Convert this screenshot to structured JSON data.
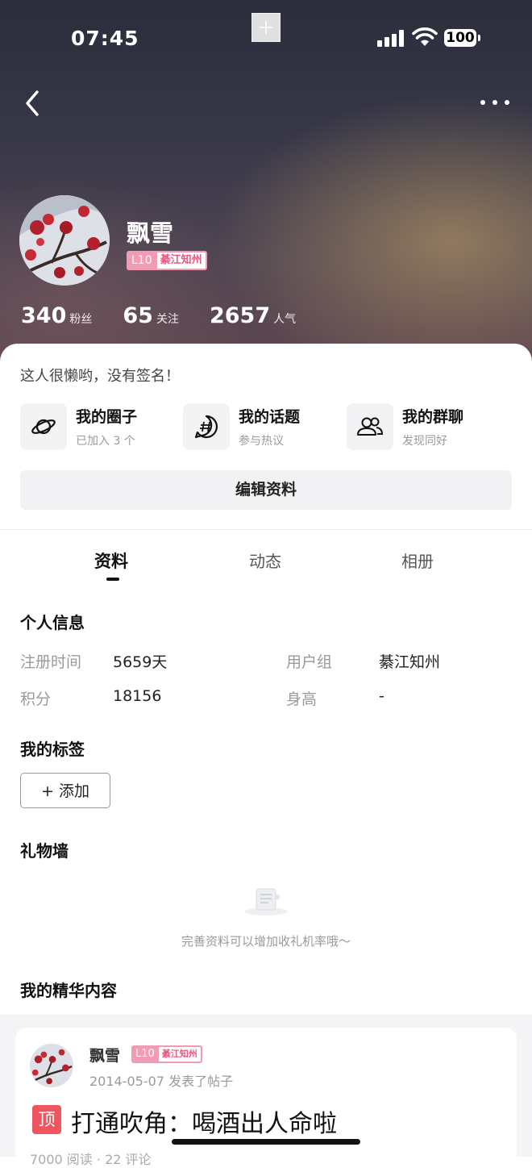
{
  "status_bar": {
    "time": "07:45",
    "battery": "100"
  },
  "profile": {
    "name": "飘雪",
    "level": "L10",
    "group_badge": "綦江知州",
    "stats": [
      {
        "value": "340",
        "label": "粉丝"
      },
      {
        "value": "65",
        "label": "关注"
      },
      {
        "value": "2657",
        "label": "人气"
      }
    ],
    "signature": "这人很懒哟，没有签名！"
  },
  "quick_links": [
    {
      "title": "我的圈子",
      "subtitle": "已加入 3 个",
      "icon": "planet-icon"
    },
    {
      "title": "我的话题",
      "subtitle": "参与热议",
      "icon": "hashtag-chat-icon"
    },
    {
      "title": "我的群聊",
      "subtitle": "发现同好",
      "icon": "group-users-icon"
    }
  ],
  "edit_button": "编辑资料",
  "tabs": [
    "资料",
    "动态",
    "相册"
  ],
  "active_tab": "资料",
  "personal_info": {
    "title": "个人信息",
    "fields": [
      {
        "label": "注册时间",
        "value": "5659天"
      },
      {
        "label": "用户组",
        "value": "綦江知州"
      },
      {
        "label": "积分",
        "value": "18156"
      },
      {
        "label": "身高",
        "value": "-"
      }
    ]
  },
  "tags": {
    "title": "我的标签",
    "add_label": "+ 添加"
  },
  "gift_wall": {
    "title": "礼物墙",
    "empty_text": "完善资料可以增加收礼机率哦～"
  },
  "featured": {
    "title": "我的精华内容",
    "post": {
      "author": "飘雪",
      "level": "L10",
      "group_badge": "綦江知州",
      "meta": "2014-05-07 发表了帖子",
      "pin_tag": "顶",
      "title": "打通吹角：喝酒出人命啦",
      "stats": "7000 阅读 · 22 评论"
    }
  },
  "colors": {
    "badge_pink": "#f29bb4",
    "pin_red": "#f0545f"
  }
}
